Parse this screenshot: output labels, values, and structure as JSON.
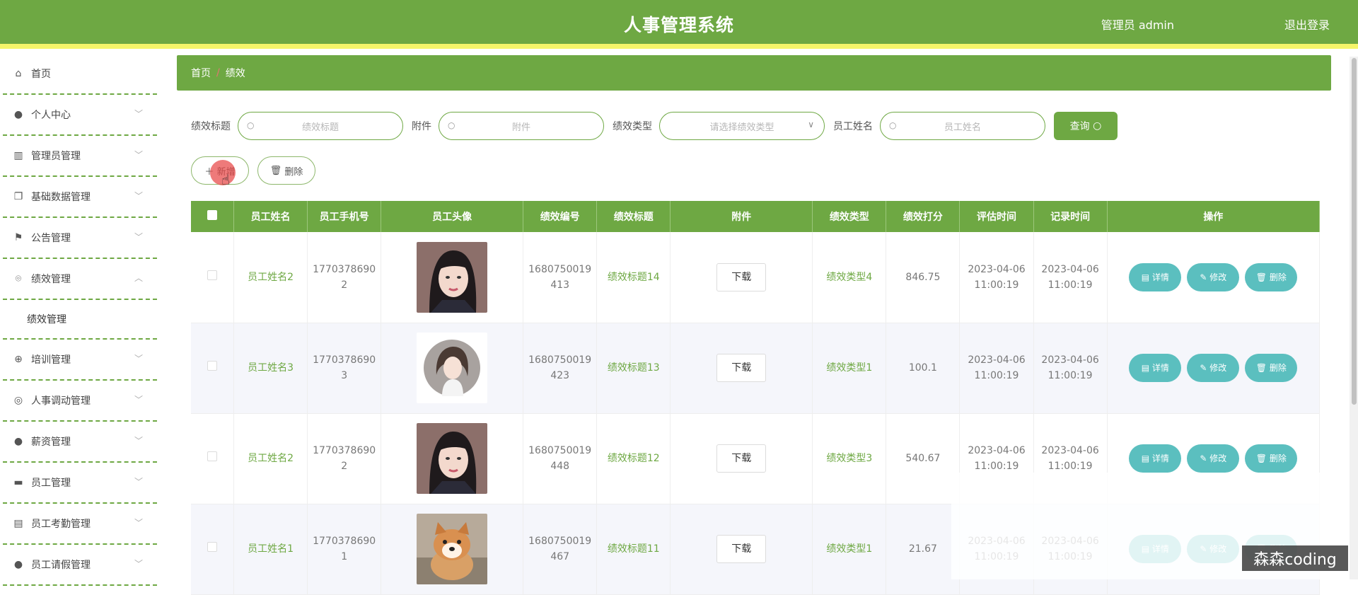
{
  "header": {
    "title": "人事管理系统",
    "user": "管理员 admin",
    "logout": "退出登录"
  },
  "sidebar": {
    "items": [
      {
        "label": "首页",
        "icon": "home-icon",
        "glyph": "⌂"
      },
      {
        "label": "个人中心",
        "icon": "person-icon",
        "glyph": "●"
      },
      {
        "label": "管理员管理",
        "icon": "books-icon",
        "glyph": "▥"
      },
      {
        "label": "基础数据管理",
        "icon": "copy-icon",
        "glyph": "❐"
      },
      {
        "label": "公告管理",
        "icon": "flag-icon",
        "glyph": "⚑"
      },
      {
        "label": "绩效管理",
        "icon": "microphone-icon",
        "glyph": "⌾"
      },
      {
        "label": "培训管理",
        "icon": "compass-icon",
        "glyph": "⊕"
      },
      {
        "label": "人事调动管理",
        "icon": "lifebuoy-icon",
        "glyph": "◎"
      },
      {
        "label": "薪资管理",
        "icon": "pin-icon",
        "glyph": "●"
      },
      {
        "label": "员工管理",
        "icon": "ticket-icon",
        "glyph": "▬"
      },
      {
        "label": "员工考勤管理",
        "icon": "clipboard-icon",
        "glyph": "▤"
      },
      {
        "label": "员工请假管理",
        "icon": "user-icon",
        "glyph": "●"
      }
    ],
    "submenu": "绩效管理"
  },
  "breadcrumb": {
    "home": "首页",
    "sep": "/",
    "current": "绩效"
  },
  "search": {
    "title_label": "绩效标题",
    "title_placeholder": "绩效标题",
    "file_label": "附件",
    "file_placeholder": "附件",
    "type_label": "绩效类型",
    "type_placeholder": "请选择绩效类型",
    "name_label": "员工姓名",
    "name_placeholder": "员工姓名",
    "query": "查询"
  },
  "actions": {
    "add": "新增",
    "delete": "删除"
  },
  "table": {
    "headers": [
      "员工姓名",
      "员工手机号",
      "员工头像",
      "绩效编号",
      "绩效标题",
      "附件",
      "绩效类型",
      "绩效打分",
      "评估时间",
      "记录时间",
      "操作"
    ],
    "download": "下载",
    "ops": {
      "detail": "详情",
      "edit": "修改",
      "delete": "删除"
    },
    "rows": [
      {
        "name": "员工姓名2",
        "phone1": "1770378690",
        "phone2": "2",
        "no1": "1680750019",
        "no2": "413",
        "title": "绩效标题14",
        "type": "绩效类型4",
        "score": "846.75",
        "eval1": "2023-04-06",
        "eval2": "11:00:19",
        "rec1": "2023-04-06",
        "rec2": "11:00:19",
        "avatar": "girl"
      },
      {
        "name": "员工姓名3",
        "phone1": "1770378690",
        "phone2": "3",
        "no1": "1680750019",
        "no2": "423",
        "title": "绩效标题13",
        "type": "绩效类型1",
        "score": "100.1",
        "eval1": "2023-04-06",
        "eval2": "11:00:19",
        "rec1": "2023-04-06",
        "rec2": "11:00:19",
        "avatar": "cartoon"
      },
      {
        "name": "员工姓名2",
        "phone1": "1770378690",
        "phone2": "2",
        "no1": "1680750019",
        "no2": "448",
        "title": "绩效标题12",
        "type": "绩效类型3",
        "score": "540.67",
        "eval1": "2023-04-06",
        "eval2": "11:00:19",
        "rec1": "2023-04-06",
        "rec2": "11:00:19",
        "avatar": "girl"
      },
      {
        "name": "员工姓名1",
        "phone1": "1770378690",
        "phone2": "1",
        "no1": "1680750019",
        "no2": "467",
        "title": "绩效标题11",
        "type": "绩效类型1",
        "score": "21.67",
        "eval1": "2023-04-06",
        "eval2": "11:00:19",
        "rec1": "2023-04-06",
        "rec2": "11:00:19",
        "avatar": "dog"
      }
    ]
  },
  "watermark": "森森coding"
}
